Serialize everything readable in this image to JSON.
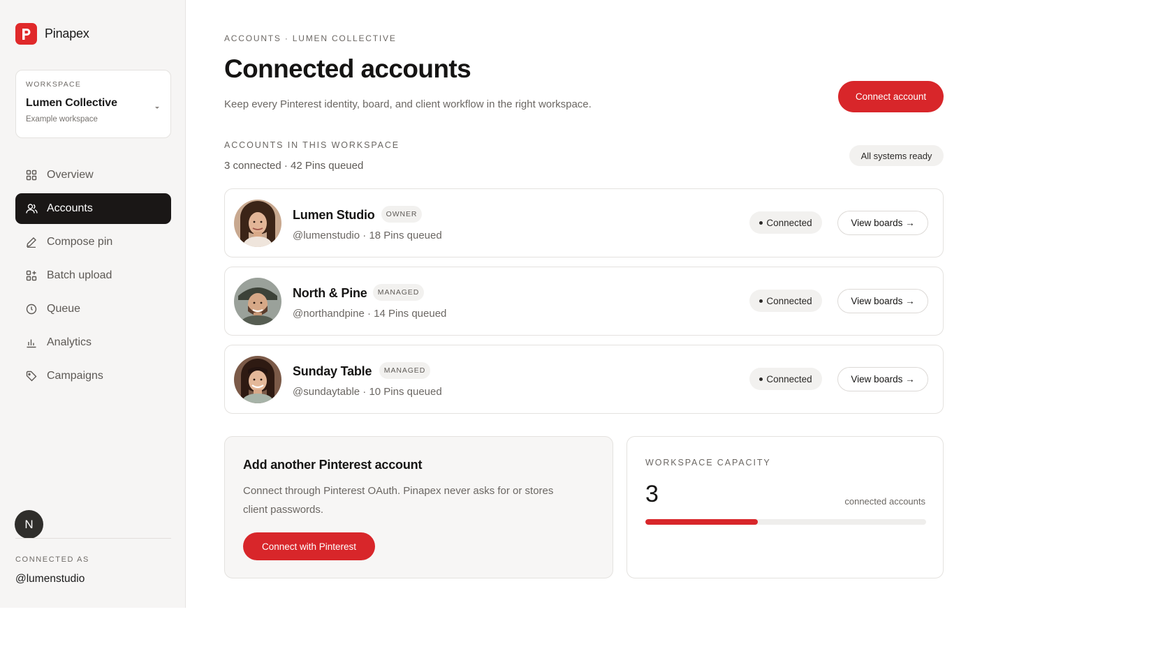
{
  "brand": {
    "name": "Pinapex",
    "logo_letter": "P",
    "icon": "pinapex-logo-icon",
    "color": "#e0292a"
  },
  "workspace": {
    "label": "WORKSPACE",
    "name": "Lumen Collective",
    "subtitle": "Example workspace",
    "icon": "chevron-down-icon"
  },
  "nav": [
    {
      "label": "Overview",
      "icon": "grid-icon",
      "active": false
    },
    {
      "label": "Accounts",
      "icon": "users-icon",
      "active": true
    },
    {
      "label": "Compose pin",
      "icon": "pencil-icon",
      "active": false
    },
    {
      "label": "Batch upload",
      "icon": "grid-plus-icon",
      "active": false
    },
    {
      "label": "Queue",
      "icon": "clock-icon",
      "active": false
    },
    {
      "label": "Analytics",
      "icon": "bar-chart-icon",
      "active": false
    },
    {
      "label": "Campaigns",
      "icon": "tag-icon",
      "active": false
    }
  ],
  "user": {
    "avatar_letter": "N",
    "connected_label": "CONNECTED AS",
    "handle": "@lumenstudio"
  },
  "header": {
    "breadcrumb": "ACCOUNTS · LUMEN COLLECTIVE",
    "title": "Connected accounts",
    "subtitle": "Keep every Pinterest identity, board, and client workflow in the right workspace.",
    "primary_button": "Connect account"
  },
  "accounts_section": {
    "label": "ACCOUNTS IN THIS WORKSPACE",
    "summary": "3 connected · 42 Pins queued",
    "status": "All systems ready"
  },
  "accounts": [
    {
      "name": "Lumen Studio",
      "role": "OWNER",
      "meta": "@lumenstudio · 18 Pins queued",
      "status": "Connected",
      "action": "View boards →"
    },
    {
      "name": "North & Pine",
      "role": "MANAGED",
      "meta": "@northandpine · 14 Pins queued",
      "status": "Connected",
      "action": "View boards →"
    },
    {
      "name": "Sunday Table",
      "role": "MANAGED",
      "meta": "@sundaytable · 10 Pins queued",
      "status": "Connected",
      "action": "View boards →"
    }
  ],
  "add_account": {
    "title": "Add another Pinterest account",
    "description": "Connect through Pinterest OAuth. Pinapex never asks for or stores client passwords.",
    "button": "Connect with Pinterest"
  },
  "capacity": {
    "label": "WORKSPACE CAPACITY",
    "value": "3",
    "unit": "connected accounts",
    "fill_fraction": 0.4
  },
  "colors": {
    "accent": "#d8262a",
    "active_nav": "#1a1716"
  }
}
